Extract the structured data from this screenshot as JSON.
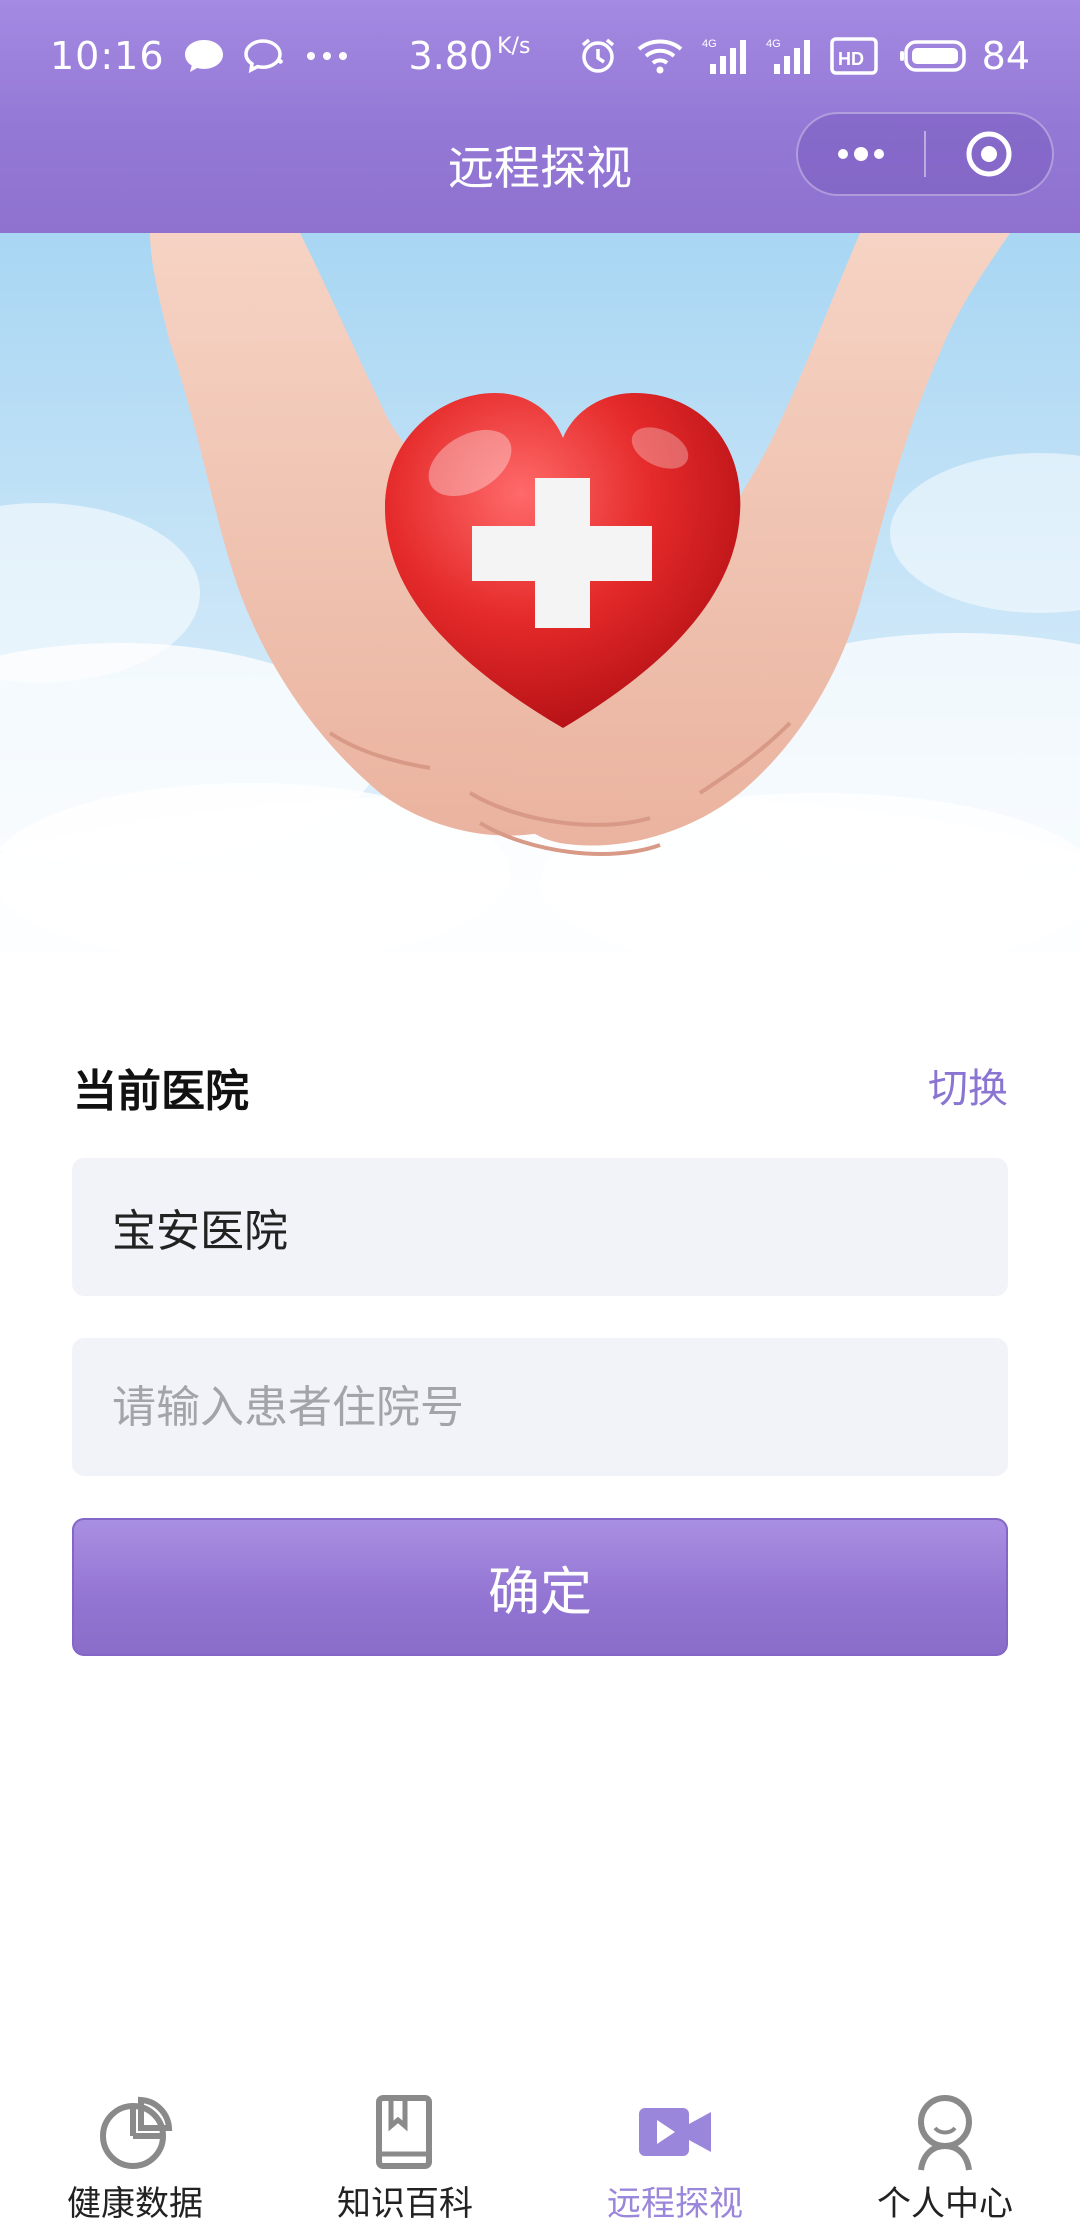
{
  "status_bar": {
    "time": "10:16",
    "speed": "3.80",
    "speed_unit": "K/s",
    "network_labels": [
      "4G",
      "4G"
    ],
    "hd_label": "HD",
    "battery": "84",
    "icons": [
      "message-icon",
      "chat-icon",
      "more-dots-icon",
      "alarm-icon",
      "wifi-icon",
      "signal-icon",
      "signal-icon",
      "hd-icon",
      "battery-icon"
    ]
  },
  "nav": {
    "title": "远程探视",
    "more_icon": "more-dots-icon",
    "close_icon": "target-icon"
  },
  "banner": {
    "image": "hands-holding-heart-with-cross",
    "colors": {
      "sky": "#bfe1f6",
      "heart": "#e52a2a"
    }
  },
  "form": {
    "section_label": "当前医院",
    "switch_label": "切换",
    "hospital_value": "宝安医院",
    "inpatient_placeholder": "请输入患者住院号",
    "inpatient_value": "",
    "confirm_label": "确定"
  },
  "tabbar": {
    "items": [
      {
        "label": "健康数据",
        "icon": "pie-chart-icon",
        "active": false
      },
      {
        "label": "知识百科",
        "icon": "book-icon",
        "active": false
      },
      {
        "label": "远程探视",
        "icon": "video-camera-icon",
        "active": true
      },
      {
        "label": "个人中心",
        "icon": "person-icon",
        "active": false
      }
    ]
  },
  "colors": {
    "accent": "#9a7fdc",
    "accent_dark": "#8a6cc9",
    "input_bg": "#f2f3f8",
    "link": "#8b75d2"
  }
}
